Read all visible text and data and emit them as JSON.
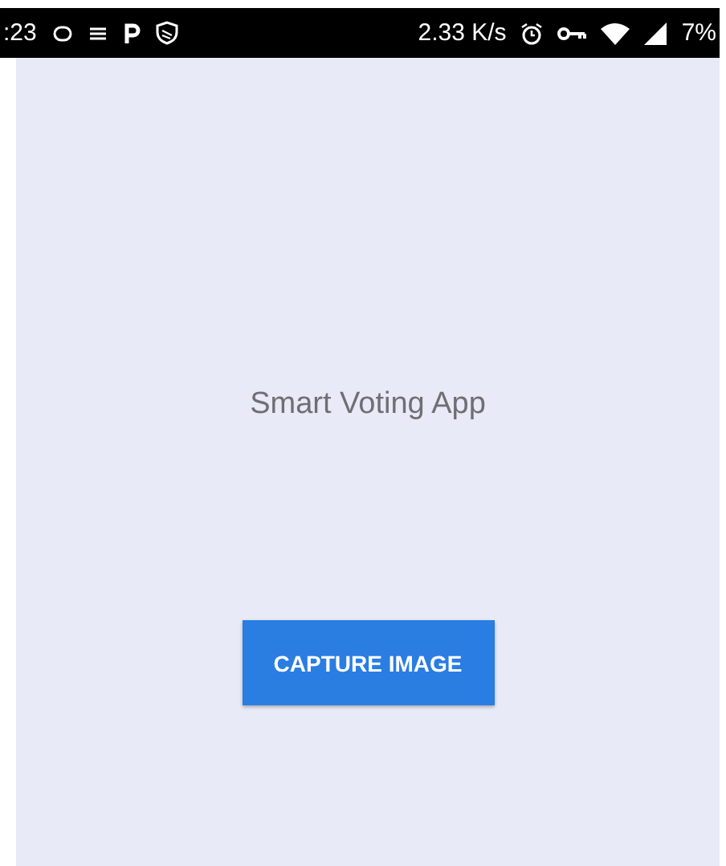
{
  "status_bar": {
    "time": ":23",
    "speed": "2.33 K/s",
    "battery": "7%"
  },
  "title": "Smart Voting App",
  "button": {
    "label": "CAPTURE IMAGE"
  }
}
